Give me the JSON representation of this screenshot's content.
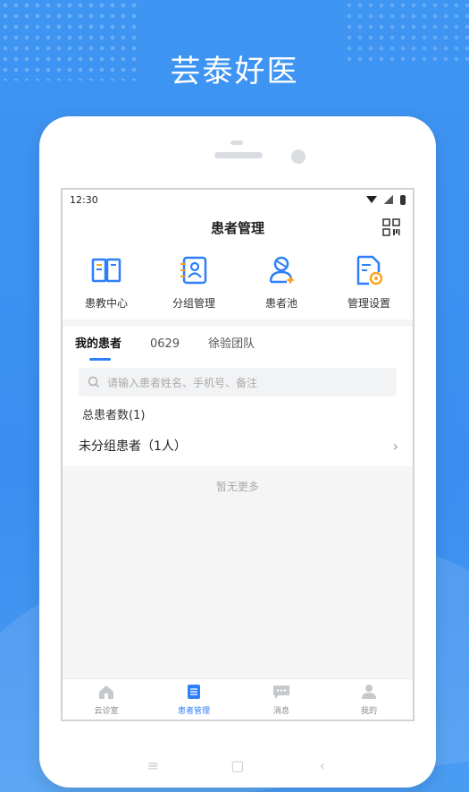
{
  "headline": "芸泰好医",
  "status": {
    "time": "12:30"
  },
  "header": {
    "title": "患者管理",
    "qr_icon": "qr-code-icon"
  },
  "quick_actions": [
    {
      "label": "患教中心",
      "icon": "book-icon"
    },
    {
      "label": "分组管理",
      "icon": "contact-card-icon"
    },
    {
      "label": "患者池",
      "icon": "patient-pool-icon"
    },
    {
      "label": "管理设置",
      "icon": "settings-doc-icon"
    }
  ],
  "tabs": [
    {
      "label": "我的患者"
    },
    {
      "label": "0629"
    },
    {
      "label": "徐验团队"
    }
  ],
  "search": {
    "placeholder": "请输入患者姓名、手机号、备注"
  },
  "summary": {
    "total_label": "总患者数(1)"
  },
  "groups": [
    {
      "label": "未分组患者（1人）"
    }
  ],
  "list_footer": "暂无更多",
  "tabbar": [
    {
      "label": "云诊室",
      "icon": "home-icon"
    },
    {
      "label": "患者管理",
      "icon": "patients-icon"
    },
    {
      "label": "消息",
      "icon": "message-icon"
    },
    {
      "label": "我的",
      "icon": "user-icon"
    }
  ],
  "colors": {
    "accent": "#2d7ff9",
    "background": "#3b8ef0"
  }
}
